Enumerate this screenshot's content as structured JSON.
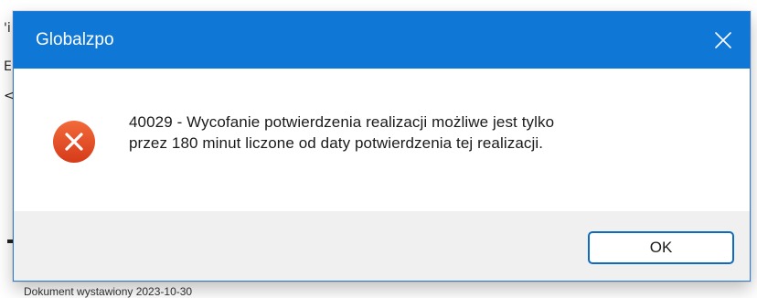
{
  "background": {
    "glyphs": [
      "'i",
      "E",
      "<"
    ],
    "bottom_text": "Dokument wystawiony 2023-10-30"
  },
  "dialog": {
    "title": "Globalzpo",
    "close_icon": "close-icon",
    "error_icon": "error-icon",
    "message_line1": "40029 - Wycofanie potwierdzenia realizacji możliwe jest tylko",
    "message_line2": "przez 180 minut liczone od daty potwierdzenia tej realizacji.",
    "ok_label": "OK",
    "colors": {
      "titlebar": "#0f78d7",
      "error": "#e24b28",
      "footer": "#f0f0f0",
      "button_border": "#0f6cbd"
    }
  }
}
